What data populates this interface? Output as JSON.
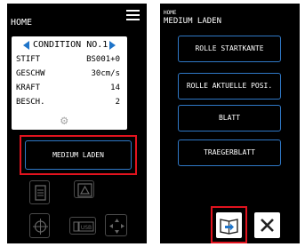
{
  "left": {
    "header_title": "HOME",
    "condition_label": "CONDITION NO.1",
    "params": [
      {
        "key": "STIFT",
        "value": "BS001+0"
      },
      {
        "key": "GESCHW",
        "value": "30cm/s"
      },
      {
        "key": "KRAFT",
        "value": "14"
      },
      {
        "key": "BESCH.",
        "value": "2"
      }
    ],
    "medium_button": "MEDIUM LADEN"
  },
  "right": {
    "breadcrumb": "HOME",
    "header_title": "MEDIUM LADEN",
    "buttons": [
      {
        "label": "ROLLE STARTKANTE"
      },
      {
        "label": "ROLLE AKTUELLE POSI."
      },
      {
        "label": "BLATT"
      },
      {
        "label": "TRAEGERBLATT"
      }
    ]
  },
  "colors": {
    "accent_blue": "#2f78c6",
    "highlight_red": "#e1131e",
    "screen_bg": "#000000"
  },
  "icons": [
    "menu-icon",
    "arrow-left-icon",
    "arrow-right-icon",
    "gear-icon",
    "document-icon",
    "triangle-test-icon",
    "crosshair-icon",
    "usb-icon",
    "move-arrows-icon",
    "book-load-icon",
    "close-icon"
  ]
}
